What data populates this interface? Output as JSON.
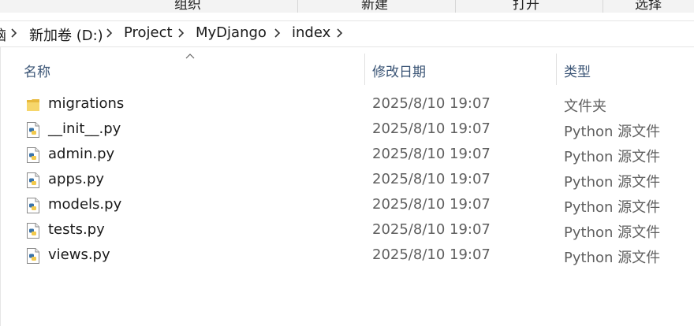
{
  "ribbon": {
    "sections": [
      "组织",
      "新建",
      "打开",
      "选择"
    ]
  },
  "address": {
    "crumbs": [
      "脑",
      "新加卷 (D:)",
      "Project",
      "MyDjango",
      "index"
    ]
  },
  "columns": {
    "name": "名称",
    "date": "修改日期",
    "type": "类型"
  },
  "files": [
    {
      "name": "migrations",
      "date": "2025/8/10 19:07",
      "type": "文件夹",
      "icon": "folder-icon"
    },
    {
      "name": "__init__.py",
      "date": "2025/8/10 19:07",
      "type": "Python 源文件",
      "icon": "python-file-icon"
    },
    {
      "name": "admin.py",
      "date": "2025/8/10 19:07",
      "type": "Python 源文件",
      "icon": "python-file-icon"
    },
    {
      "name": "apps.py",
      "date": "2025/8/10 19:07",
      "type": "Python 源文件",
      "icon": "python-file-icon"
    },
    {
      "name": "models.py",
      "date": "2025/8/10 19:07",
      "type": "Python 源文件",
      "icon": "python-file-icon"
    },
    {
      "name": "tests.py",
      "date": "2025/8/10 19:07",
      "type": "Python 源文件",
      "icon": "python-file-icon"
    },
    {
      "name": "views.py",
      "date": "2025/8/10 19:07",
      "type": "Python 源文件",
      "icon": "python-file-icon"
    }
  ]
}
